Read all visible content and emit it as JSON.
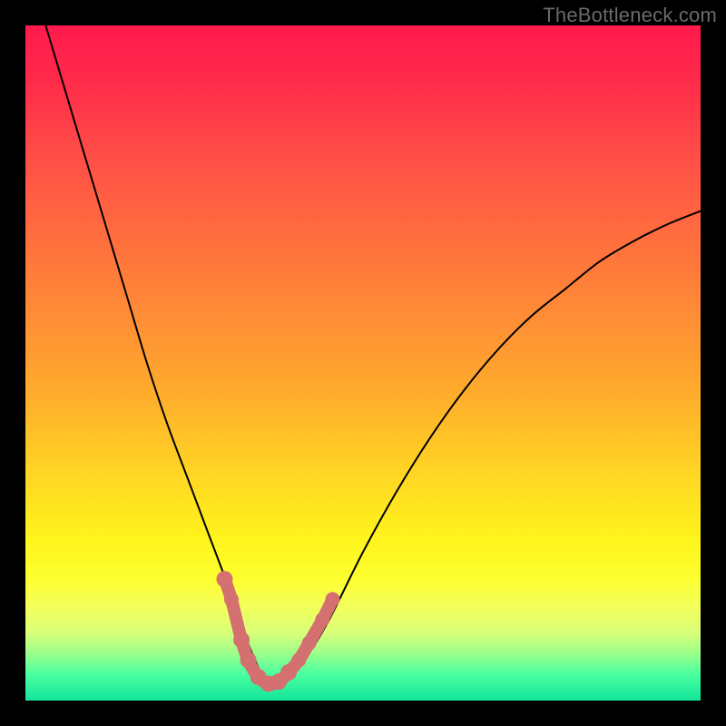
{
  "watermark": "TheBottleneck.com",
  "palette": {
    "top": "#ff1a4d",
    "mid": "#fff41c",
    "bottom": "#13e59b",
    "curve": "#000000",
    "marker": "#d47070",
    "frame": "#000000"
  },
  "chart_data": {
    "type": "line",
    "title": "",
    "xlabel": "",
    "ylabel": "",
    "xlim": [
      0,
      100
    ],
    "ylim": [
      0,
      100
    ],
    "grid": false,
    "legend": false,
    "series": [
      {
        "name": "bottleneck-curve",
        "x": [
          0,
          3,
          6,
          9,
          12,
          15,
          18,
          21,
          24,
          27,
          30,
          32,
          34,
          35,
          36,
          37,
          38,
          40,
          42,
          45,
          50,
          55,
          60,
          65,
          70,
          75,
          80,
          85,
          90,
          95,
          100
        ],
        "y": [
          110,
          100,
          90,
          80,
          70,
          60,
          50,
          41,
          33,
          25,
          17,
          11,
          6,
          4,
          3,
          2.5,
          3,
          4.5,
          7,
          12,
          22,
          31,
          39,
          46,
          52,
          57,
          61,
          65,
          68,
          70.5,
          72.5
        ]
      }
    ],
    "markers": [
      {
        "x": 29.5,
        "y": 18,
        "r": 9
      },
      {
        "x": 30.5,
        "y": 15,
        "r": 8
      },
      {
        "x": 32.0,
        "y": 9,
        "r": 9
      },
      {
        "x": 33.0,
        "y": 6,
        "r": 9
      },
      {
        "x": 34.5,
        "y": 3.5,
        "r": 9
      },
      {
        "x": 36.0,
        "y": 2.5,
        "r": 9
      },
      {
        "x": 37.5,
        "y": 2.8,
        "r": 9
      },
      {
        "x": 39.0,
        "y": 4.2,
        "r": 9
      },
      {
        "x": 40.5,
        "y": 6.0,
        "r": 8
      },
      {
        "x": 42.0,
        "y": 8.5,
        "r": 8
      },
      {
        "x": 44.0,
        "y": 12.0,
        "r": 8
      },
      {
        "x": 45.5,
        "y": 15.0,
        "r": 8
      }
    ]
  }
}
